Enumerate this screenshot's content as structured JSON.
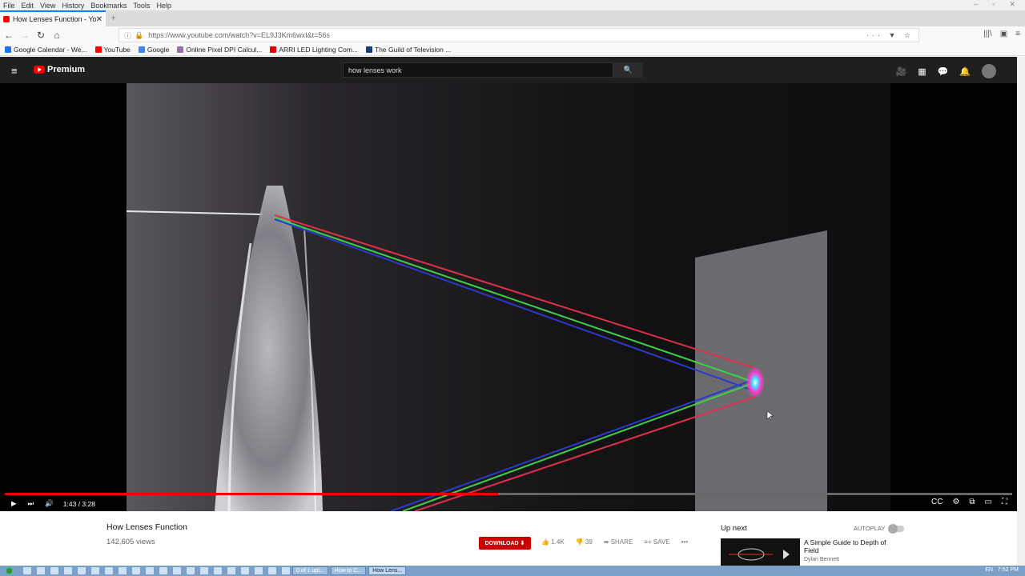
{
  "menubar": {
    "items": [
      "File",
      "Edit",
      "View",
      "History",
      "Bookmarks",
      "Tools",
      "Help"
    ]
  },
  "tab": {
    "title": "How Lenses Function - Yo",
    "close": "✕",
    "new": "+"
  },
  "nav": {
    "back": "←",
    "forward": "→",
    "reload": "↻",
    "home": "⌂",
    "info": "ⓘ",
    "lock": "🔒",
    "url": "https://www.youtube.com/watch?v=EL9J3Km6wxI&t=56s",
    "url_tail": "··· ▼ ☆",
    "right_icons": [
      "|||\\",
      "▣",
      "≡"
    ]
  },
  "bookmarks": [
    {
      "label": "Google Calendar - We...",
      "color": "#1a73e8"
    },
    {
      "label": "YouTube",
      "color": "#ff0000"
    },
    {
      "label": "Google",
      "color": "#4285f4"
    },
    {
      "label": "Online Pixel DPI Calcul...",
      "color": "#9a6fb0"
    },
    {
      "label": "ARRI LED Lighting Com...",
      "color": "#e00000"
    },
    {
      "label": "The Guild of Television ...",
      "color": "#1b3c7a"
    }
  ],
  "youtube": {
    "hamburger": "≡",
    "logo_text": "Premium",
    "search_value": "how lenses work",
    "search_icon": "🔍",
    "right_icons": [
      "🎥",
      "▦",
      "💬",
      "🔔"
    ]
  },
  "player": {
    "progress_fraction": 0.49,
    "play": "▶",
    "next": "⏭",
    "volume": "🔊",
    "time": "1:43 / 3:28",
    "right_icons": [
      "CC",
      "⚙",
      "⧉",
      "▭",
      "⛶"
    ]
  },
  "video_info": {
    "title": "How Lenses Function",
    "views": "142,605 views",
    "download": "DOWNLOAD",
    "likes": "1.4K",
    "dislikes": "39",
    "share": "SHARE",
    "save": "SAVE",
    "more": "•••",
    "like_icon": "👍",
    "dislike_icon": "👎",
    "share_icon": "➦",
    "save_icon": "≡+"
  },
  "sidebar": {
    "up_next": "Up next",
    "autoplay": "AUTOPLAY",
    "rec_title": "A Simple Guide to Depth of Field",
    "rec_channel": "Dylan Bennett"
  },
  "taskbar": {
    "tasks": [
      "0 of 1 upl...",
      "How to C...",
      "How Lens..."
    ],
    "right": [
      "EN",
      "7:52 PM"
    ]
  },
  "colors": {
    "yt_red": "#ff0000",
    "ray_red": "#e0304a",
    "ray_green": "#3fd04a",
    "ray_blue": "#2a3acc",
    "focus": "#ff3cd2"
  }
}
